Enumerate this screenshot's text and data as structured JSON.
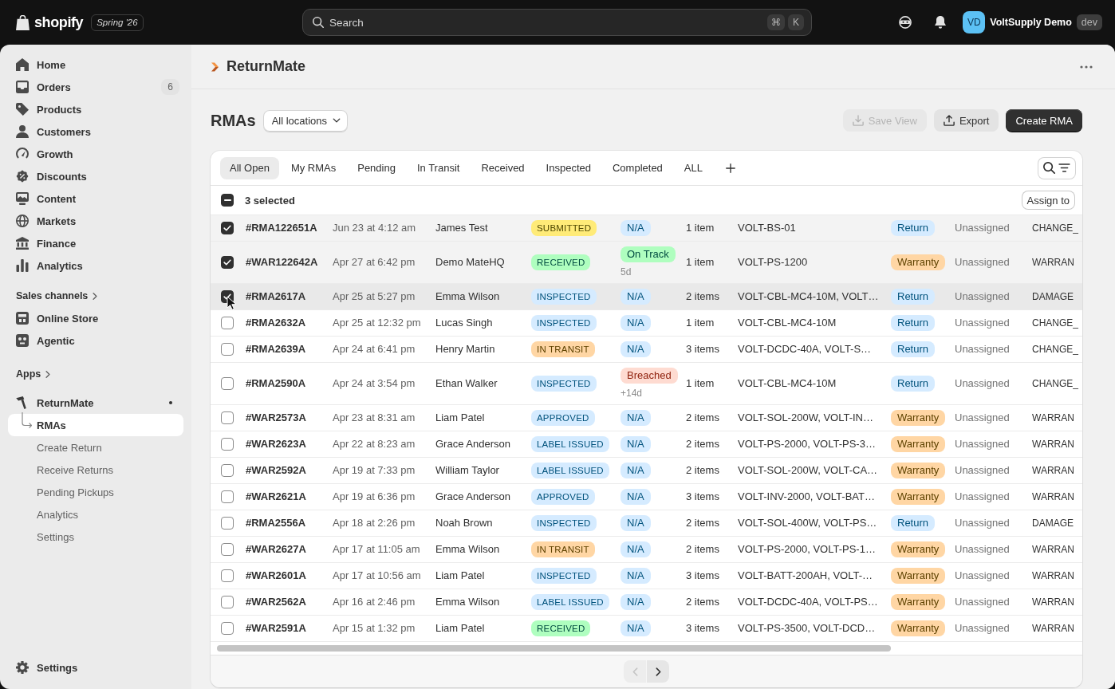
{
  "top_bar": {
    "logo_text": "shopify",
    "edition": "Spring '26",
    "search": {
      "placeholder": "Search",
      "shortcut": [
        "⌘",
        "K"
      ]
    },
    "account": {
      "initials": "VD",
      "name": "VoltSupply Demo",
      "environment": "dev"
    }
  },
  "sidebar": {
    "items": [
      {
        "label": "Home",
        "selected": false
      },
      {
        "label": "Orders",
        "count": "6",
        "selected": false
      },
      {
        "label": "Products",
        "selected": false
      },
      {
        "label": "Customers",
        "selected": false
      },
      {
        "label": "Growth",
        "selected": false
      },
      {
        "label": "Discounts",
        "selected": false
      },
      {
        "label": "Content",
        "selected": false
      },
      {
        "label": "Markets",
        "selected": false
      },
      {
        "label": "Finance",
        "selected": false
      },
      {
        "label": "Analytics",
        "selected": false
      }
    ],
    "sales_channels": {
      "title": "Sales channels",
      "items": [
        {
          "label": "Online Store",
          "selected": false
        },
        {
          "label": "Agentic",
          "selected": false
        }
      ]
    },
    "apps": {
      "title": "Apps",
      "items": [
        {
          "label": "ReturnMate",
          "selected": false,
          "children": [
            {
              "label": "RMAs",
              "selected": true
            },
            {
              "label": "Create Return",
              "selected": false
            },
            {
              "label": "Receive Returns",
              "selected": false
            },
            {
              "label": "Pending Pickups",
              "selected": false
            },
            {
              "label": "Analytics",
              "selected": false
            },
            {
              "label": "Settings",
              "selected": false
            }
          ]
        }
      ]
    },
    "footer_item": {
      "label": "Settings",
      "selected": false
    }
  },
  "app_header": {
    "title": "ReturnMate"
  },
  "page": {
    "title": "RMAs",
    "location_filter": "All locations",
    "actions": [
      {
        "label": "Save View",
        "kind": "secondary",
        "disabled": true
      },
      {
        "label": "Export",
        "kind": "secondary",
        "disabled": false
      },
      {
        "label": "Create RMA",
        "kind": "primary",
        "disabled": false
      }
    ]
  },
  "tabs": [
    {
      "label": "All Open",
      "selected": true
    },
    {
      "label": "My RMAs",
      "selected": false
    },
    {
      "label": "Pending",
      "selected": false
    },
    {
      "label": "In Transit",
      "selected": false
    },
    {
      "label": "Received",
      "selected": false
    },
    {
      "label": "Inspected",
      "selected": false
    },
    {
      "label": "Completed",
      "selected": false
    },
    {
      "label": "ALL",
      "selected": false
    }
  ],
  "bulk_actions": {
    "indeterminate": true,
    "label": "3 selected",
    "action": "Assign to"
  },
  "rows": [
    {
      "selected": true,
      "hovered": false,
      "id": "#RMA122651A",
      "date": "Jun 23 at 4:12 am",
      "customer": "James Test",
      "status": {
        "text": "SUBMITTED",
        "color": "#ffeb78"
      },
      "sla": {
        "text": "N/A",
        "color": "#d5ebff"
      },
      "items": "1 item",
      "skus": "VOLT-BS-01",
      "type": {
        "text": "Return",
        "color": "#d5ebff"
      },
      "assignee": "Unassigned",
      "column_11": "CHANGE_"
    },
    {
      "selected": true,
      "hovered": false,
      "id": "#WAR122642A",
      "date": "Apr 27 at 6:42 pm",
      "customer": "Demo MateHQ",
      "status": {
        "text": "RECEIVED",
        "color": "#affebf"
      },
      "sla": {
        "text": "On Track",
        "color": "#affebf",
        "note": "5d"
      },
      "items": "1 item",
      "skus": "VOLT-PS-1200",
      "type": {
        "text": "Warranty",
        "color": "#ffd6a4"
      },
      "assignee": "Unassigned",
      "column_11": "WARRAN"
    },
    {
      "selected": true,
      "hovered": true,
      "id": "#RMA2617A",
      "date": "Apr 25 at 5:27 pm",
      "customer": "Emma Wilson",
      "status": {
        "text": "INSPECTED",
        "color": "#d5ebff"
      },
      "sla": {
        "text": "N/A",
        "color": "#d5ebff"
      },
      "items": "2 items",
      "skus": "VOLT-CBL-MC4-10M, VOLT…",
      "type": {
        "text": "Return",
        "color": "#d5ebff"
      },
      "assignee": "Unassigned",
      "column_11": "DAMAGE"
    },
    {
      "selected": false,
      "hovered": false,
      "id": "#RMA2632A",
      "date": "Apr 25 at 12:32 pm",
      "customer": "Lucas Singh",
      "status": {
        "text": "INSPECTED",
        "color": "#d5ebff"
      },
      "sla": {
        "text": "N/A",
        "color": "#d5ebff"
      },
      "items": "1 item",
      "skus": "VOLT-CBL-MC4-10M",
      "type": {
        "text": "Return",
        "color": "#d5ebff"
      },
      "assignee": "Unassigned",
      "column_11": "CHANGE_"
    },
    {
      "selected": false,
      "hovered": false,
      "id": "#RMA2639A",
      "date": "Apr 24 at 6:41 pm",
      "customer": "Henry Martin",
      "status": {
        "text": "IN TRANSIT",
        "color": "#ffd6a4"
      },
      "sla": {
        "text": "N/A",
        "color": "#d5ebff"
      },
      "items": "3 items",
      "skus": "VOLT-DCDC-40A, VOLT-S…",
      "type": {
        "text": "Return",
        "color": "#d5ebff"
      },
      "assignee": "Unassigned",
      "column_11": "CHANGE_"
    },
    {
      "selected": false,
      "hovered": false,
      "id": "#RMA2590A",
      "date": "Apr 24 at 3:54 pm",
      "customer": "Ethan Walker",
      "status": {
        "text": "INSPECTED",
        "color": "#d5ebff"
      },
      "sla": {
        "text": "Breached",
        "color": "#fedbd1",
        "note": "+14d"
      },
      "items": "1 item",
      "skus": "VOLT-CBL-MC4-10M",
      "type": {
        "text": "Return",
        "color": "#d5ebff"
      },
      "assignee": "Unassigned",
      "column_11": "CHANGE_"
    },
    {
      "selected": false,
      "hovered": false,
      "id": "#WAR2573A",
      "date": "Apr 23 at 8:31 am",
      "customer": "Liam Patel",
      "status": {
        "text": "APPROVED",
        "color": "#d5ebff"
      },
      "sla": {
        "text": "N/A",
        "color": "#d5ebff"
      },
      "items": "2 items",
      "skus": "VOLT-SOL-200W, VOLT-IN…",
      "type": {
        "text": "Warranty",
        "color": "#ffd6a4"
      },
      "assignee": "Unassigned",
      "column_11": "WARRAN"
    },
    {
      "selected": false,
      "hovered": false,
      "id": "#WAR2623A",
      "date": "Apr 22 at 8:23 am",
      "customer": "Grace Anderson",
      "status": {
        "text": "LABEL ISSUED",
        "color": "#d5ebff"
      },
      "sla": {
        "text": "N/A",
        "color": "#d5ebff"
      },
      "items": "2 items",
      "skus": "VOLT-PS-2000, VOLT-PS-3…",
      "type": {
        "text": "Warranty",
        "color": "#ffd6a4"
      },
      "assignee": "Unassigned",
      "column_11": "WARRAN"
    },
    {
      "selected": false,
      "hovered": false,
      "id": "#WAR2592A",
      "date": "Apr 19 at 7:33 pm",
      "customer": "William Taylor",
      "status": {
        "text": "LABEL ISSUED",
        "color": "#d5ebff"
      },
      "sla": {
        "text": "N/A",
        "color": "#d5ebff"
      },
      "items": "2 items",
      "skus": "VOLT-SOL-200W, VOLT-CA…",
      "type": {
        "text": "Warranty",
        "color": "#ffd6a4"
      },
      "assignee": "Unassigned",
      "column_11": "WARRAN"
    },
    {
      "selected": false,
      "hovered": false,
      "id": "#WAR2621A",
      "date": "Apr 19 at 6:36 pm",
      "customer": "Grace Anderson",
      "status": {
        "text": "APPROVED",
        "color": "#d5ebff"
      },
      "sla": {
        "text": "N/A",
        "color": "#d5ebff"
      },
      "items": "3 items",
      "skus": "VOLT-INV-2000, VOLT-BAT…",
      "type": {
        "text": "Warranty",
        "color": "#ffd6a4"
      },
      "assignee": "Unassigned",
      "column_11": "WARRAN"
    },
    {
      "selected": false,
      "hovered": false,
      "id": "#RMA2556A",
      "date": "Apr 18 at 2:26 pm",
      "customer": "Noah Brown",
      "status": {
        "text": "INSPECTED",
        "color": "#d5ebff"
      },
      "sla": {
        "text": "N/A",
        "color": "#d5ebff"
      },
      "items": "2 items",
      "skus": "VOLT-SOL-400W, VOLT-PS…",
      "type": {
        "text": "Return",
        "color": "#d5ebff"
      },
      "assignee": "Unassigned",
      "column_11": "DAMAGE"
    },
    {
      "selected": false,
      "hovered": false,
      "id": "#WAR2627A",
      "date": "Apr 17 at 11:05 am",
      "customer": "Emma Wilson",
      "status": {
        "text": "IN TRANSIT",
        "color": "#ffd6a4"
      },
      "sla": {
        "text": "N/A",
        "color": "#d5ebff"
      },
      "items": "2 items",
      "skus": "VOLT-PS-2000, VOLT-PS-1…",
      "type": {
        "text": "Warranty",
        "color": "#ffd6a4"
      },
      "assignee": "Unassigned",
      "column_11": "WARRAN"
    },
    {
      "selected": false,
      "hovered": false,
      "id": "#WAR2601A",
      "date": "Apr 17 at 10:56 am",
      "customer": "Liam Patel",
      "status": {
        "text": "INSPECTED",
        "color": "#d5ebff"
      },
      "sla": {
        "text": "N/A",
        "color": "#d5ebff"
      },
      "items": "3 items",
      "skus": "VOLT-BATT-200AH, VOLT-…",
      "type": {
        "text": "Warranty",
        "color": "#ffd6a4"
      },
      "assignee": "Unassigned",
      "column_11": "WARRAN"
    },
    {
      "selected": false,
      "hovered": false,
      "id": "#WAR2562A",
      "date": "Apr 16 at 2:46 pm",
      "customer": "Emma Wilson",
      "status": {
        "text": "LABEL ISSUED",
        "color": "#d5ebff"
      },
      "sla": {
        "text": "N/A",
        "color": "#d5ebff"
      },
      "items": "2 items",
      "skus": "VOLT-DCDC-40A, VOLT-PS…",
      "type": {
        "text": "Warranty",
        "color": "#ffd6a4"
      },
      "assignee": "Unassigned",
      "column_11": "WARRAN"
    },
    {
      "selected": false,
      "hovered": false,
      "id": "#WAR2591A",
      "date": "Apr 15 at 1:32 pm",
      "customer": "Liam Patel",
      "status": {
        "text": "RECEIVED",
        "color": "#affebf"
      },
      "sla": {
        "text": "N/A",
        "color": "#d5ebff"
      },
      "items": "3 items",
      "skus": "VOLT-PS-3500, VOLT-DCD…",
      "type": {
        "text": "Warranty",
        "color": "#ffd6a4"
      },
      "assignee": "Unassigned",
      "column_11": "WARRAN"
    }
  ],
  "pagination": {
    "previous_disabled": true,
    "next_disabled": false
  }
}
